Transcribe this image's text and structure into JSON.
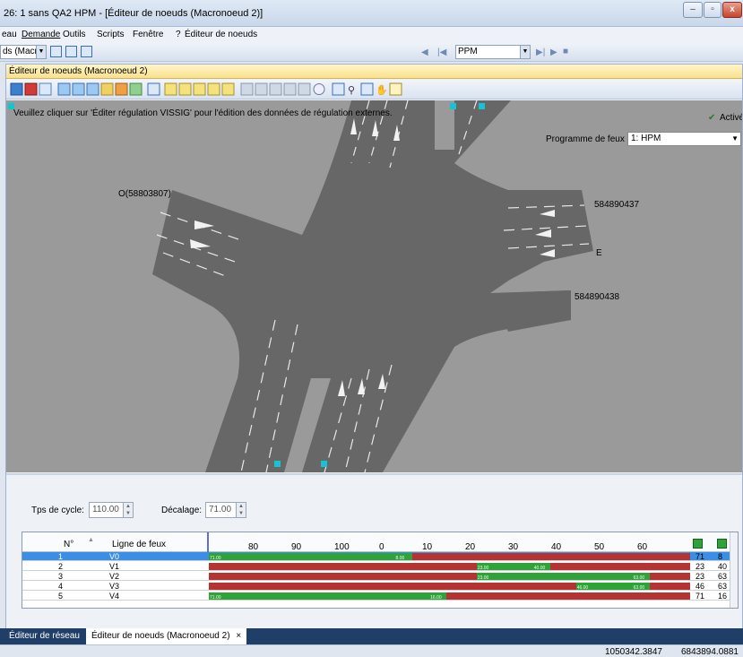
{
  "window": {
    "title": "26: 1 sans QA2 HPM  - [Éditeur de noeuds (Macronoeud 2)]",
    "minimize": "–",
    "restore": "▫",
    "close": "x"
  },
  "menu": [
    "eau",
    "Demande",
    "Outils",
    "Scripts",
    "Fenêtre",
    "?",
    "Éditeur de noeuds"
  ],
  "toolbar": {
    "node_combo": "ds (Macr​",
    "playback_combo": "PPM"
  },
  "editor": {
    "title": "Éditeur de noeuds (Macronoeud 2)",
    "notice": "Veuillez cliquer sur 'Éditer régulation VISSIG' pour l'édition des données de régulation externes.",
    "active_label": "Activé",
    "program_label": "Programme de feux :",
    "program_value": "1: HPM",
    "labels": {
      "west": "O(58803807)",
      "east_upper": "584890437",
      "east_letter": "E",
      "east_lower": "584890438"
    }
  },
  "signal": {
    "cycle_label": "Tps de cycle:",
    "cycle_value": "110.00",
    "offset_label": "Décalage:",
    "offset_value": "71.00",
    "headers": {
      "num": "N°",
      "name": "Ligne de feux",
      "ticks": [
        "80",
        "90",
        "100",
        "0",
        "10",
        "20",
        "30",
        "40",
        "50",
        "60"
      ]
    },
    "rows": [
      {
        "num": "1",
        "name": "V0",
        "a": "71",
        "b": "8",
        "green_label_start": "71.00",
        "green_label_end": "8.00"
      },
      {
        "num": "2",
        "name": "V1",
        "a": "23",
        "b": "40",
        "green_label_start": "23.00",
        "green_label_end": "40.00"
      },
      {
        "num": "3",
        "name": "V2",
        "a": "23",
        "b": "63",
        "green_label_start": "23.00",
        "green_label_end": "63.00"
      },
      {
        "num": "4",
        "name": "V3",
        "a": "46",
        "b": "63",
        "green_label_start": "46.00",
        "green_label_end": "63.00"
      },
      {
        "num": "5",
        "name": "V4",
        "a": "71",
        "b": "16",
        "green_label_start": "71.00",
        "green_label_end": "16.00"
      }
    ]
  },
  "tabs": [
    "Éditeur de réseau",
    "Éditeur de noeuds (Macronoeud 2)",
    "×"
  ],
  "status": {
    "x": "1050342.3847",
    "y": "6843894.0881"
  },
  "colors": {
    "green": "#2fa33a",
    "red": "#b43333",
    "selection": "#3a8ee6",
    "road": "#676767"
  }
}
